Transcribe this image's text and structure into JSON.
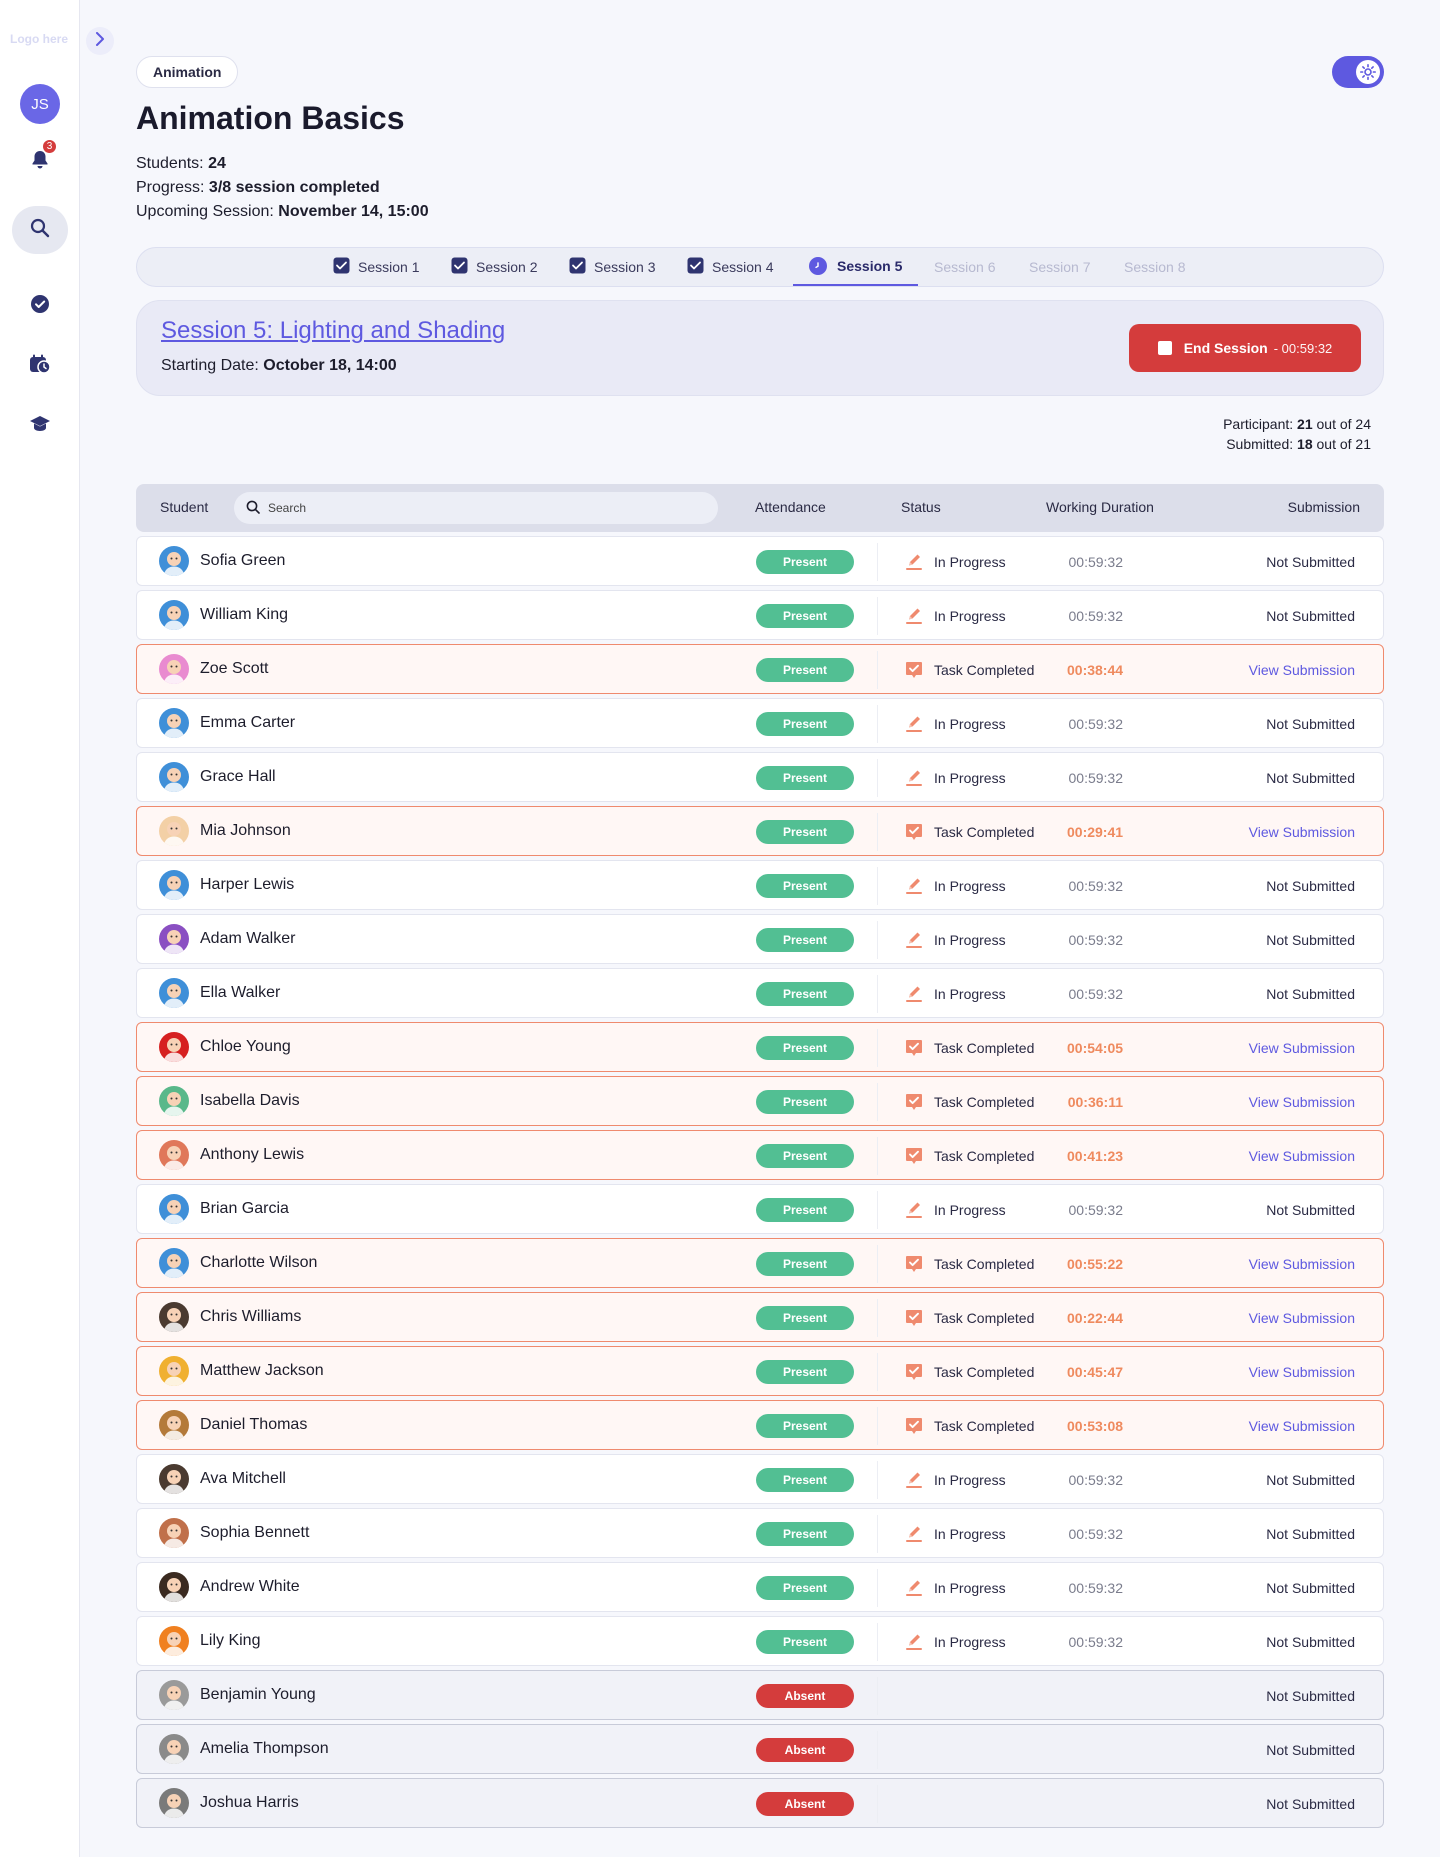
{
  "sidebar": {
    "logo": "Logo here",
    "user_initials": "JS",
    "notifications_count": "3"
  },
  "header": {
    "chip": "Animation",
    "title": "Animation Basics",
    "students_label": "Students:",
    "students_value": "24",
    "progress_label": "Progress:",
    "progress_value": "3/8 session completed",
    "upcoming_label": "Upcoming Session:",
    "upcoming_value": "November 14, 15:00"
  },
  "tabs": [
    {
      "label": "Session 1",
      "state": "done"
    },
    {
      "label": "Session 2",
      "state": "done"
    },
    {
      "label": "Session 3",
      "state": "done"
    },
    {
      "label": "Session 4",
      "state": "done"
    },
    {
      "label": "Session 5",
      "state": "active"
    },
    {
      "label": "Session 6",
      "state": "future"
    },
    {
      "label": "Session 7",
      "state": "future"
    },
    {
      "label": "Session 8",
      "state": "future"
    }
  ],
  "session": {
    "title": "Session 5: Lighting and Shading",
    "date_label": "Starting Date:",
    "date_value": "October 18, 14:00",
    "end_label": "End Session",
    "end_timer": "- 00:59:32"
  },
  "summary": {
    "participant_label": "Participant:",
    "participant_value": "21",
    "participant_total": "out of 24",
    "submitted_label": "Submitted:",
    "submitted_value": "18",
    "submitted_total": "out of 21"
  },
  "table": {
    "headers": {
      "student": "Student",
      "attendance": "Attendance",
      "status": "Status",
      "duration": "Working Duration",
      "submission": "Submission"
    },
    "search_placeholder": "Search",
    "rows": [
      {
        "name": "Sofia Green",
        "attendance": "Present",
        "status": "In Progress",
        "duration": "00:59:32",
        "submission": "Not Submitted",
        "color": "#3f8fd8"
      },
      {
        "name": "William King",
        "attendance": "Present",
        "status": "In Progress",
        "duration": "00:59:32",
        "submission": "Not Submitted",
        "color": "#3f8fd8"
      },
      {
        "name": "Zoe Scott",
        "attendance": "Present",
        "status": "Task Completed",
        "duration": "00:38:44",
        "submission": "View Submission",
        "color": "#e98bd0"
      },
      {
        "name": "Emma Carter",
        "attendance": "Present",
        "status": "In Progress",
        "duration": "00:59:32",
        "submission": "Not Submitted",
        "color": "#3f8fd8"
      },
      {
        "name": "Grace Hall",
        "attendance": "Present",
        "status": "In Progress",
        "duration": "00:59:32",
        "submission": "Not Submitted",
        "color": "#3f8fd8"
      },
      {
        "name": "Mia Johnson",
        "attendance": "Present",
        "status": "Task Completed",
        "duration": "00:29:41",
        "submission": "View Submission",
        "color": "#f3d0a6"
      },
      {
        "name": "Harper Lewis",
        "attendance": "Present",
        "status": "In Progress",
        "duration": "00:59:32",
        "submission": "Not Submitted",
        "color": "#3f8fd8"
      },
      {
        "name": "Adam Walker",
        "attendance": "Present",
        "status": "In Progress",
        "duration": "00:59:32",
        "submission": "Not Submitted",
        "color": "#8a4fc2"
      },
      {
        "name": "Ella Walker",
        "attendance": "Present",
        "status": "In Progress",
        "duration": "00:59:32",
        "submission": "Not Submitted",
        "color": "#3f8fd8"
      },
      {
        "name": "Chloe Young",
        "attendance": "Present",
        "status": "Task Completed",
        "duration": "00:54:05",
        "submission": "View Submission",
        "color": "#d62020"
      },
      {
        "name": "Isabella Davis",
        "attendance": "Present",
        "status": "Task Completed",
        "duration": "00:36:11",
        "submission": "View Submission",
        "color": "#59b88a"
      },
      {
        "name": "Anthony Lewis",
        "attendance": "Present",
        "status": "Task Completed",
        "duration": "00:41:23",
        "submission": "View Submission",
        "color": "#e0785a"
      },
      {
        "name": "Brian Garcia",
        "attendance": "Present",
        "status": "In Progress",
        "duration": "00:59:32",
        "submission": "Not Submitted",
        "color": "#3f8fd8"
      },
      {
        "name": "Charlotte Wilson",
        "attendance": "Present",
        "status": "Task Completed",
        "duration": "00:55:22",
        "submission": "View Submission",
        "color": "#3f8fd8"
      },
      {
        "name": "Chris Williams",
        "attendance": "Present",
        "status": "Task Completed",
        "duration": "00:22:44",
        "submission": "View Submission",
        "color": "#4a3a30"
      },
      {
        "name": "Matthew Jackson",
        "attendance": "Present",
        "status": "Task Completed",
        "duration": "00:45:47",
        "submission": "View Submission",
        "color": "#f0b030"
      },
      {
        "name": "Daniel Thomas",
        "attendance": "Present",
        "status": "Task Completed",
        "duration": "00:53:08",
        "submission": "View Submission",
        "color": "#b47a3a"
      },
      {
        "name": "Ava Mitchell",
        "attendance": "Present",
        "status": "In Progress",
        "duration": "00:59:32",
        "submission": "Not Submitted",
        "color": "#4a3a30"
      },
      {
        "name": "Sophia Bennett",
        "attendance": "Present",
        "status": "In Progress",
        "duration": "00:59:32",
        "submission": "Not Submitted",
        "color": "#c0704a"
      },
      {
        "name": "Andrew White",
        "attendance": "Present",
        "status": "In Progress",
        "duration": "00:59:32",
        "submission": "Not Submitted",
        "color": "#3a2a20"
      },
      {
        "name": "Lily King",
        "attendance": "Present",
        "status": "In Progress",
        "duration": "00:59:32",
        "submission": "Not Submitted",
        "color": "#f08020"
      },
      {
        "name": "Benjamin Young",
        "attendance": "Absent",
        "status": "",
        "duration": "",
        "submission": "Not Submitted",
        "color": "#9a9a9a"
      },
      {
        "name": "Amelia Thompson",
        "attendance": "Absent",
        "status": "",
        "duration": "",
        "submission": "Not Submitted",
        "color": "#8a8a8a"
      },
      {
        "name": "Joshua Harris",
        "attendance": "Absent",
        "status": "",
        "duration": "",
        "submission": "Not Submitted",
        "color": "#7a7a7a"
      }
    ]
  },
  "colors": {
    "accent": "#5e59e0",
    "present": "#52bf93",
    "absent": "#d43c3c",
    "completed_border": "#ef8a6e"
  }
}
